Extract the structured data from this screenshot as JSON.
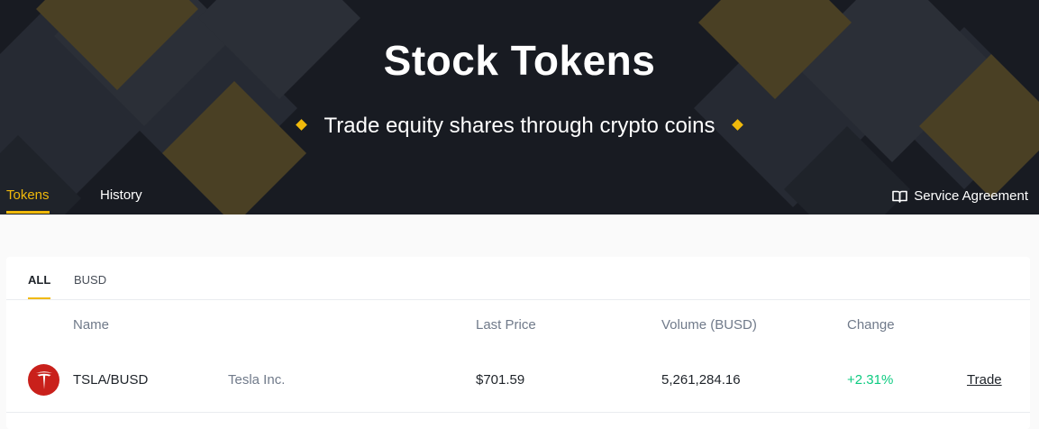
{
  "hero": {
    "title": "Stock Tokens",
    "subtitle": "Trade equity shares through crypto coins"
  },
  "nav": {
    "tabs": [
      {
        "label": "Tokens",
        "active": true
      },
      {
        "label": "History",
        "active": false
      }
    ],
    "service_agreement": "Service Agreement"
  },
  "filters": [
    {
      "label": "ALL",
      "active": true
    },
    {
      "label": "BUSD",
      "active": false
    }
  ],
  "table": {
    "headers": {
      "name": "Name",
      "last_price": "Last Price",
      "volume": "Volume (BUSD)",
      "change": "Change"
    },
    "rows": [
      {
        "icon": "tesla-logo-icon",
        "pair": "TSLA/BUSD",
        "company": "Tesla Inc.",
        "last_price": "$701.59",
        "volume": "5,261,284.16",
        "change": "+2.31%",
        "action": "Trade"
      }
    ]
  },
  "colors": {
    "accent": "#f0b90b",
    "hero_bg": "#181b22",
    "positive": "#0ecb81",
    "tesla_red": "#c9201b"
  }
}
